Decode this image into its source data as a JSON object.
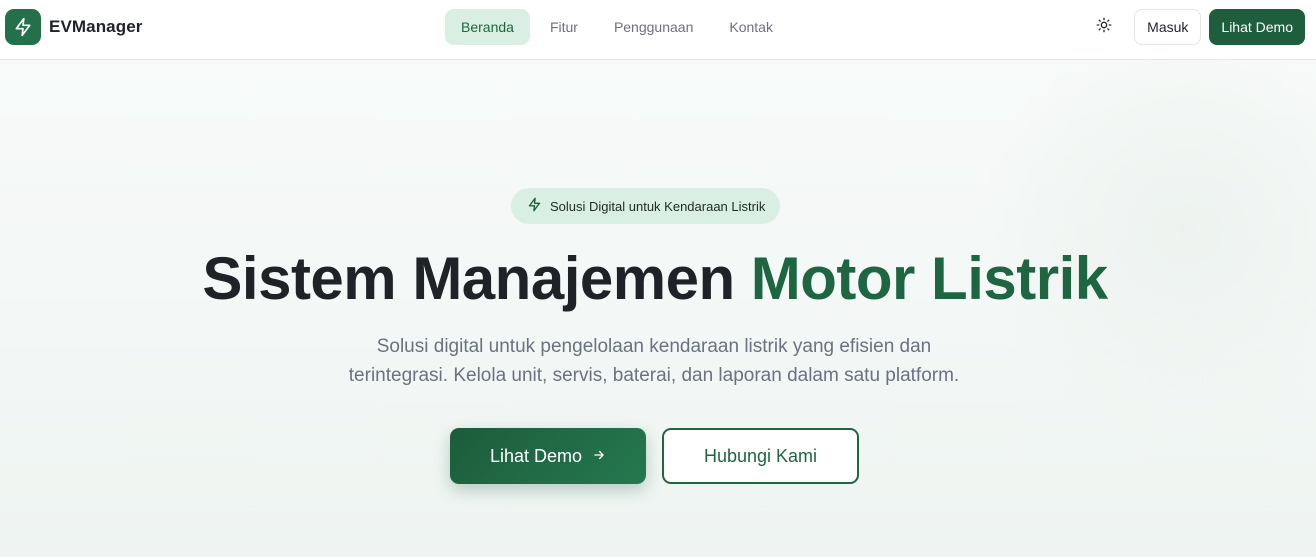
{
  "brand": {
    "name": "EVManager",
    "icon": "lightning-bolt-icon",
    "accent_color": "#24704a"
  },
  "nav": {
    "items": [
      {
        "label": "Beranda",
        "active": true
      },
      {
        "label": "Fitur",
        "active": false
      },
      {
        "label": "Penggunaan",
        "active": false
      },
      {
        "label": "Kontak",
        "active": false
      }
    ]
  },
  "header_actions": {
    "theme_icon": "sun-icon",
    "login_label": "Masuk",
    "demo_label": "Lihat Demo"
  },
  "hero": {
    "badge_icon": "lightning-bolt-icon",
    "badge_text": "Solusi Digital untuk Kendaraan Listrik",
    "title_main": "Sistem Manajemen ",
    "title_accent": "Motor Listrik",
    "subtitle_line1": "Solusi digital untuk pengelolaan kendaraan listrik yang efisien dan",
    "subtitle_line2": "terintegrasi. Kelola unit, servis, baterai, dan laporan dalam satu platform.",
    "primary_button": "Lihat Demo",
    "primary_button_icon": "arrow-right-icon",
    "secondary_button": "Hubungi Kami"
  },
  "colors": {
    "primary": "#1e5e3c",
    "primary_text": "#1e6642",
    "active_nav_bg": "#d9efe3",
    "muted_text": "#6b7280"
  }
}
